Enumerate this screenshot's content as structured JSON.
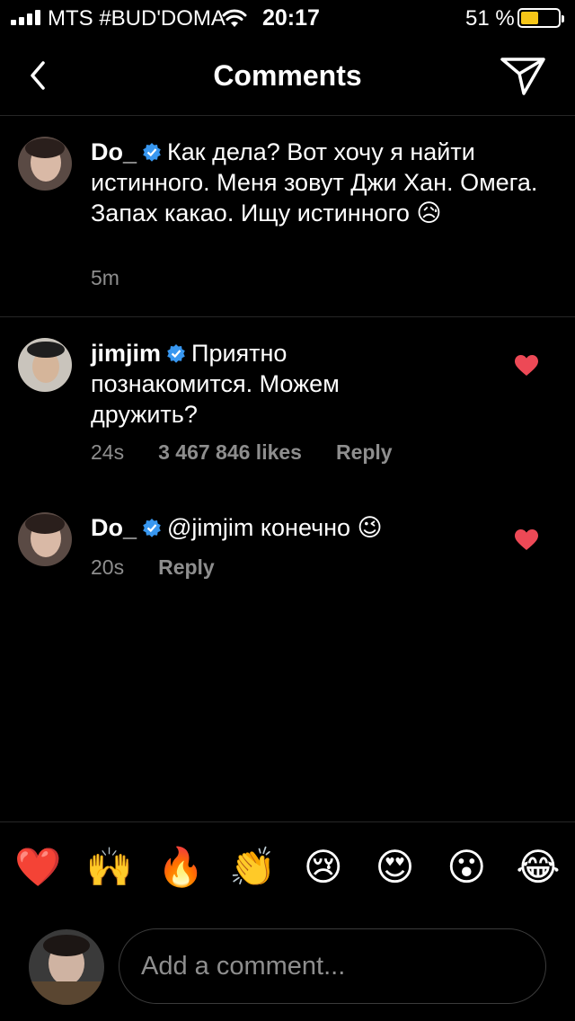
{
  "status_bar": {
    "carrier": "MTS #BUD'DOMA",
    "time": "20:17",
    "battery_percent": "51 %",
    "battery_level": 0.51,
    "battery_color": "#f5c518"
  },
  "header": {
    "back_icon": "chevron-left",
    "title": "Comments",
    "send_icon": "paper-plane"
  },
  "comments": [
    {
      "username": "Do_",
      "verified": true,
      "text": "Как дела? Вот хочу я найти истинного. Меня зовут Джи Хан. Омега. Запах какао. Ищу истинного 😥",
      "time": "5m"
    },
    {
      "username": "jimjim",
      "verified": true,
      "text": "Приятно познакомится. Можем дружить?",
      "time": "24s",
      "likes": "3 467 846 likes",
      "reply": "Reply",
      "liked": true
    },
    {
      "username": "Do_",
      "verified": true,
      "text": "@jimjim конечно 😉",
      "time": "20s",
      "reply": "Reply",
      "liked": true
    }
  ],
  "emoji_bar": [
    "❤️",
    "🙌",
    "🔥",
    "👏",
    "😢",
    "😍",
    "😮",
    "😂"
  ],
  "input": {
    "placeholder": "Add a comment..."
  },
  "colors": {
    "background": "#000000",
    "text": "#ffffff",
    "muted": "#8e8e8e",
    "verified": "#3897f0",
    "heart": "#ed4956",
    "divider": "#262626"
  }
}
